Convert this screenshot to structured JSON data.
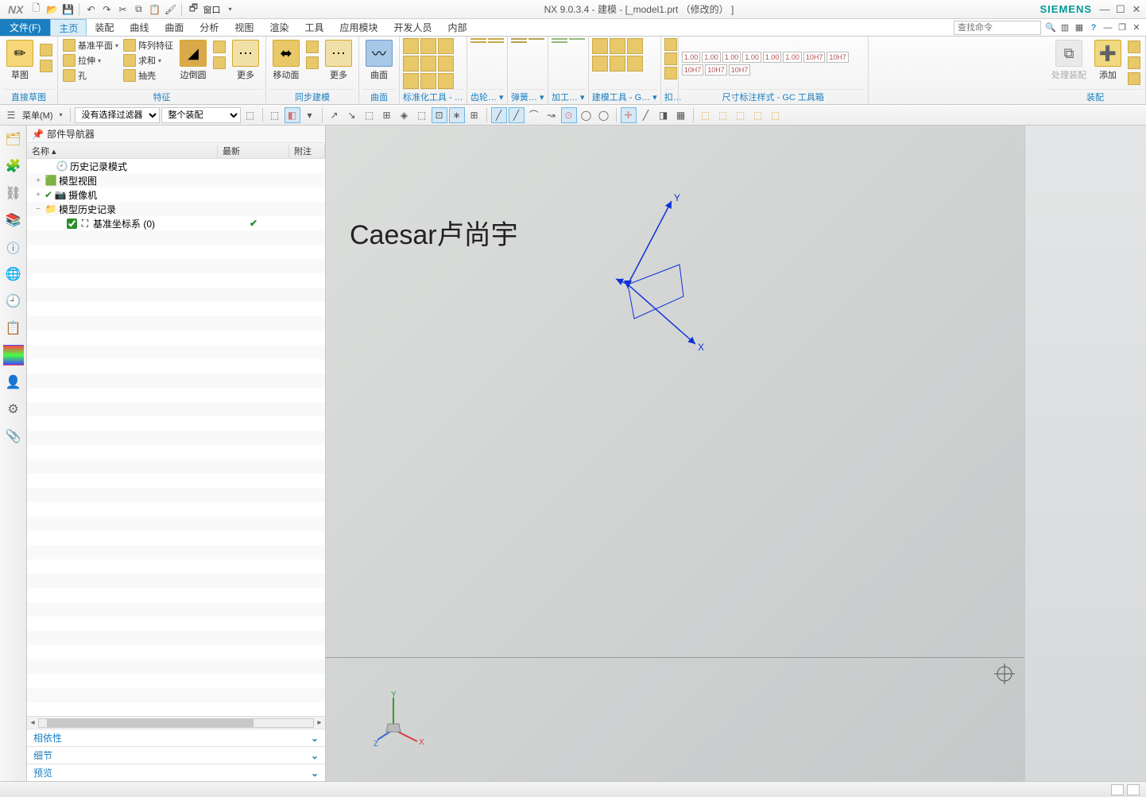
{
  "app": {
    "logo": "NX",
    "title": "NX 9.0.3.4 - 建模 - [_model1.prt  （修改的） ]",
    "brand": "SIEMENS"
  },
  "titlebar_window_menu": "窗口",
  "menubar": {
    "file": "文件(F)",
    "tabs": [
      "主页",
      "装配",
      "曲线",
      "曲面",
      "分析",
      "视图",
      "渲染",
      "工具",
      "应用模块",
      "开发人员",
      "内部"
    ],
    "search_placeholder": "查找命令"
  },
  "ribbon": {
    "group_sketch": {
      "label": "直接草图",
      "btn_sketch": "草图"
    },
    "group_feature": {
      "label": "特征",
      "rows": [
        "基准平面",
        "拉伸",
        "孔"
      ],
      "rows2": [
        "阵列特征",
        "求和",
        "抽壳"
      ],
      "chamfer": "边倒圆",
      "more": "更多"
    },
    "group_sync": {
      "label": "同步建模",
      "moveface": "移动面",
      "more": "更多"
    },
    "group_surface": {
      "label": "曲面",
      "surf": "曲面"
    },
    "group_std": {
      "label": "标准化工具 - …"
    },
    "group_gear": {
      "label": "齿轮… ▾"
    },
    "group_spring": {
      "label": "弹簧… ▾"
    },
    "group_machine": {
      "label": "加工… ▾"
    },
    "group_modeltool": {
      "label": "建模工具 - G… ▾"
    },
    "group_dim": {
      "label": "尺寸标注样式 - GC 工具箱",
      "vals": [
        "1.00",
        "1.00",
        "1.00",
        "1.00",
        "1.00",
        "1.00",
        "10H7",
        "10H7",
        "10H7",
        "10H7",
        "10H7"
      ]
    },
    "group_asm": {
      "label": "装配",
      "process": "处理装配",
      "add": "添加"
    }
  },
  "toolbar2": {
    "menu": "菜单(M)",
    "filter": "没有选择过滤器",
    "scope": "整个装配"
  },
  "nav": {
    "title": "部件导航器",
    "cols": [
      "名称 ▴",
      "最新",
      "附注"
    ],
    "rows": [
      {
        "indent": 1,
        "exp": "",
        "icon": "🕘",
        "label": "历史记录模式",
        "chk": false,
        "latest": ""
      },
      {
        "indent": 0,
        "exp": "+",
        "icon": "🟩",
        "label": "模型视图",
        "chk": false,
        "latest": ""
      },
      {
        "indent": 0,
        "exp": "+",
        "icon": "📷",
        "label": "摄像机",
        "chk": false,
        "latest": "",
        "pre": "✔"
      },
      {
        "indent": 0,
        "exp": "−",
        "icon": "📁",
        "label": "模型历史记录",
        "chk": false,
        "latest": ""
      },
      {
        "indent": 2,
        "exp": "",
        "icon": "⛶",
        "label": "基准坐标系 (0)",
        "chk": true,
        "latest": "✔"
      }
    ],
    "sections": [
      "相依性",
      "细节",
      "预览"
    ]
  },
  "viewport": {
    "watermark": "Caesar卢尚宇",
    "axes": {
      "x": "X",
      "y": "Y",
      "z": "Z"
    }
  }
}
